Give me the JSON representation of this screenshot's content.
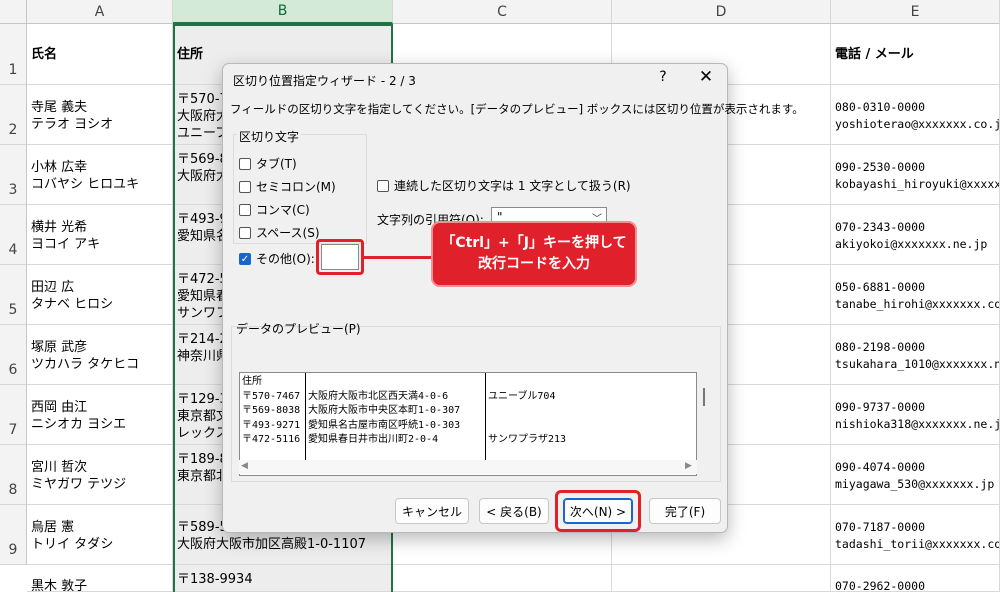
{
  "sheet": {
    "columns": [
      "A",
      "B",
      "C",
      "D",
      "E"
    ],
    "row_numbers": [
      "1",
      "2",
      "3",
      "4",
      "5",
      "6",
      "7",
      "8",
      "9"
    ],
    "header": {
      "name": "氏名",
      "address": "住所",
      "contact": "電話 / メール"
    },
    "rows": [
      {
        "name1": "寺尾 義夫",
        "name2": "テラオ ヨシオ",
        "addr1": "〒570-7",
        "addr2": "大阪府大",
        "addr3": "ユニーフ",
        "phone": "080-0310-0000",
        "email": "yoshioterao@xxxxxxx.co.j"
      },
      {
        "name1": "小林 広幸",
        "name2": "コバヤシ ヒロユキ",
        "addr1": "〒569-8",
        "addr2": "大阪府大",
        "addr3": "",
        "phone": "090-2530-0000",
        "email": "kobayashi_hiroyuki@xxxxx"
      },
      {
        "name1": "横井 光希",
        "name2": "ヨコイ アキ",
        "addr1": "〒493-9",
        "addr2": "愛知県名",
        "addr3": "",
        "phone": "070-2343-0000",
        "email": "akiyokoi@xxxxxxx.ne.jp"
      },
      {
        "name1": "田辺 広",
        "name2": "タナベ ヒロシ",
        "addr1": "〒472-5",
        "addr2": "愛知県春",
        "addr3": "サンワフ",
        "phone": "050-6881-0000",
        "email": "tanabe_hirohi@xxxxxxx.co"
      },
      {
        "name1": "塚原 武彦",
        "name2": "ツカハラ タケヒコ",
        "addr1": "〒214-2",
        "addr2": "神奈川県",
        "addr3": "",
        "phone": "080-2198-0000",
        "email": "tsukahara_1010@xxxxxxx.n"
      },
      {
        "name1": "西岡 由江",
        "name2": "ニシオカ ヨシエ",
        "addr1": "〒129-3",
        "addr2": "東京都文",
        "addr3": "レックス",
        "phone": "090-9737-0000",
        "email": "nishioka318@xxxxxxx.ne.j"
      },
      {
        "name1": "宮川 哲次",
        "name2": "ミヤガワ テツジ",
        "addr1": "〒189-8",
        "addr2": "東京都北",
        "addr3": "",
        "phone": "090-4074-0000",
        "email": "miyagawa_530@xxxxxxx.jp"
      },
      {
        "name1": "烏居 憲",
        "name2": "トリイ タダシ",
        "addr1": "〒589-5",
        "addr2": "大阪府大阪市加区高殿1-0-1107",
        "addr3": "",
        "phone": "070-7187-0000",
        "email": "tadashi_torii@xxxxxxx.co"
      },
      {
        "name1": "黒木 敦子",
        "name2": "",
        "addr1": "〒138-9934",
        "addr2": "",
        "addr3": "",
        "phone": "070-2962-0000",
        "email": ""
      }
    ]
  },
  "dialog": {
    "title": "区切り位置指定ウィザード - 2 / 3",
    "help": "?",
    "close": "✕",
    "description": "フィールドの区切り文字を指定してください。[データのプレビュー] ボックスには区切り位置が表示されます。",
    "delimiters_legend": "区切り文字",
    "delimiters": [
      {
        "label": "タブ(T)",
        "checked": false
      },
      {
        "label": "セミコロン(M)",
        "checked": false
      },
      {
        "label": "コンマ(C)",
        "checked": false
      },
      {
        "label": "スペース(S)",
        "checked": false
      },
      {
        "label": "その他(O):",
        "checked": true
      }
    ],
    "other_value": "",
    "consecutive_label": "連続した区切り文字は 1 文字として扱う(R)",
    "consecutive_checked": false,
    "quote_label": "文字列の引用符(Q):",
    "quote_value": "\"",
    "preview_legend": "データのプレビュー(P)",
    "preview_rows": [
      [
        "住所",
        "",
        ""
      ],
      [
        "〒570-7467",
        "大阪府大阪市北区西天満4-0-6",
        "ユニーブル704"
      ],
      [
        "〒569-8038",
        "大阪府大阪市中央区本町1-0-307",
        ""
      ],
      [
        "〒493-9271",
        "愛知県名古屋市南区呼続1-0-303",
        ""
      ],
      [
        "〒472-5116",
        "愛知県春日井市出川町2-0-4",
        "サンワプラザ213"
      ]
    ],
    "buttons": {
      "cancel": "キャンセル",
      "back": "< 戻る(B)",
      "next": "次へ(N) >",
      "finish": "完了(F)"
    }
  },
  "annotation": {
    "line1": "「Ctrl」+「J」キーを押して",
    "line2": "改行コードを入力",
    "color": "#e0202a"
  },
  "colors": {
    "selection": "#217346",
    "accent": "#1a66c8"
  }
}
